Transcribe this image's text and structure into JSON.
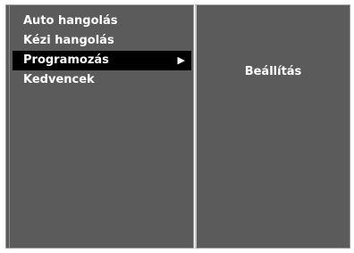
{
  "menu": {
    "items": [
      {
        "label": "Auto hangolás"
      },
      {
        "label": "Kézi hangolás"
      },
      {
        "label": "Programozás"
      },
      {
        "label": "Kedvencek"
      }
    ],
    "selected_index": 2,
    "selected_arrow": "▶"
  },
  "submenu": {
    "label": "Beállítás"
  },
  "colors": {
    "panel_bg": "#5b5b5b",
    "selected_bg": "#000000",
    "text": "#ffffff"
  }
}
